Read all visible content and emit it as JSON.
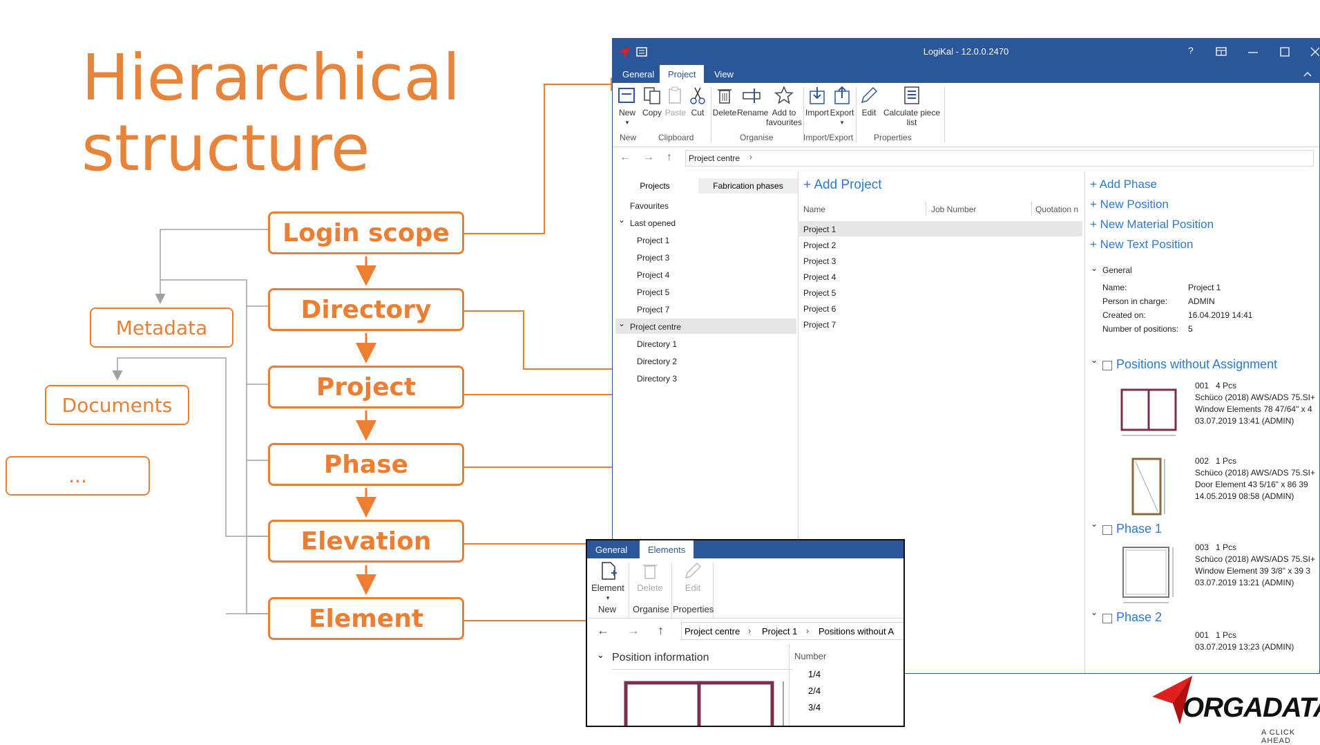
{
  "slide": {
    "title_line1": "Hierarchical",
    "title_line2": "structure",
    "hierarchy": [
      "Login scope",
      "Directory",
      "Project",
      "Phase",
      "Elevation",
      "Element"
    ],
    "side_boxes": [
      "Metadata",
      "Documents",
      "..."
    ],
    "accent": "#ed7d31"
  },
  "app": {
    "title": "LogiKal - 12.0.0.2470",
    "window_controls": [
      "?",
      "restore-layout-icon",
      "minimize-icon",
      "maximize-icon",
      "close-icon"
    ],
    "menu_tabs": [
      "General",
      "Project",
      "View"
    ],
    "ribbon": {
      "buttons": [
        "New",
        "Copy",
        "Paste",
        "Cut",
        "Delete",
        "Rename",
        "Add to favourites",
        "Import",
        "Export",
        "Edit",
        "Calculate piece list"
      ],
      "groups": [
        "New",
        "Clipboard",
        "Organise",
        "Import/Export",
        "Properties"
      ]
    },
    "breadcrumb": "Project centre",
    "left_tabs": [
      "Projects",
      "Fabrication phases"
    ],
    "tree": {
      "favourites": "Favourites",
      "last_opened": "Last opened",
      "last_items": [
        "Project 1",
        "Project 3",
        "Project 4",
        "Project 5",
        "Project 7"
      ],
      "project_centre": "Project centre",
      "directories": [
        "Directory 1",
        "Directory 2",
        "Directory 3"
      ]
    },
    "middle": {
      "add_project": "Add Project",
      "columns": [
        "Name",
        "Job Number",
        "Quotation n"
      ],
      "projects": [
        "Project 1",
        "Project 2",
        "Project 3",
        "Project 4",
        "Project 5",
        "Project 6",
        "Project 7"
      ]
    },
    "right": {
      "actions": [
        "Add Phase",
        "New Position",
        "New Material Position",
        "New Text Position"
      ],
      "general_header": "General",
      "general": {
        "name_label": "Name:",
        "name_value": "Project 1",
        "person_label": "Person in charge:",
        "person_value": "ADMIN",
        "created_label": "Created on:",
        "created_value": "16.04.2019 14:41",
        "count_label": "Number of positions:",
        "count_value": "5"
      },
      "sections": [
        "Positions without Assignment",
        "Phase 1",
        "Phase 2"
      ],
      "positions": [
        {
          "no": "001",
          "qty": "4 Pcs",
          "line1": "Schüco (2018) AWS/ADS 75.SI+",
          "line2": "Window Elements 78 47/64\" x 4",
          "date": "03.07.2019 13:41 (ADMIN)"
        },
        {
          "no": "002",
          "qty": "1 Pcs",
          "line1": "Schüco (2018) AWS/ADS 75.SI+",
          "line2": "Door Element 43 5/16\" x 86 39",
          "date": "14.05.2019 08:58 (ADMIN)"
        },
        {
          "no": "003",
          "qty": "1 Pcs",
          "line1": "Schüco (2018) AWS/ADS 75.SI+",
          "line2": "Window Element 39 3/8\" x 39 3",
          "date": "03.07.2019 13:21 (ADMIN)"
        },
        {
          "no": "001",
          "qty": "1 Pcs",
          "line1": "",
          "line2": "",
          "date": "03.07.2019 13:23 (ADMIN)"
        }
      ]
    }
  },
  "app2": {
    "menu_tabs": [
      "General",
      "Elements"
    ],
    "buttons": [
      "Element",
      "Delete",
      "Edit"
    ],
    "groups": [
      "New",
      "Organise",
      "Properties"
    ],
    "breadcrumb": [
      "Project centre",
      "Project 1",
      "Positions without A"
    ],
    "section": "Position information",
    "number_header": "Number",
    "numbers": [
      "1/4",
      "2/4",
      "3/4"
    ]
  },
  "logo": {
    "name": "ORGADATA",
    "tagline": "A CLICK AHEAD"
  }
}
